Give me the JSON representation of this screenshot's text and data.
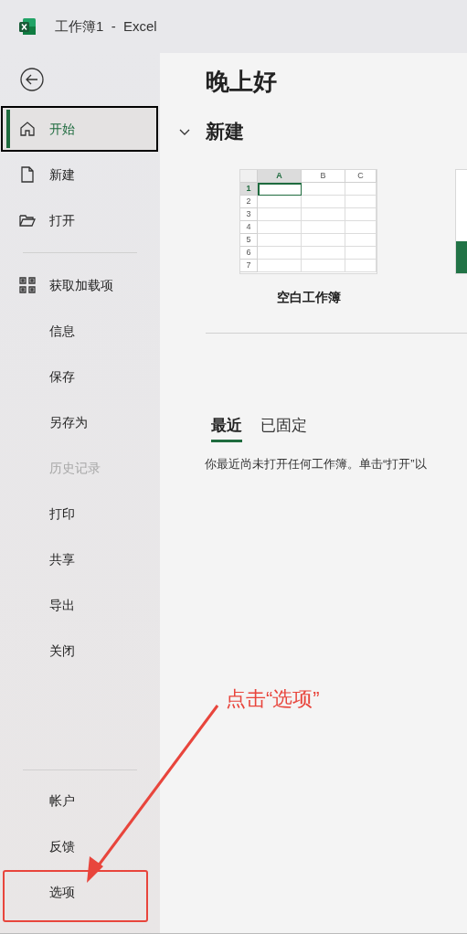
{
  "window": {
    "title": "工作簿1  -  Excel"
  },
  "sidebar": {
    "primary": [
      {
        "label": "开始",
        "selected": true,
        "disabled": false
      },
      {
        "label": "新建",
        "selected": false,
        "disabled": false
      },
      {
        "label": "打开",
        "selected": false,
        "disabled": false
      }
    ],
    "middle": [
      {
        "label": "获取加载项",
        "selected": false,
        "disabled": false
      },
      {
        "label": "信息",
        "selected": false,
        "disabled": false
      },
      {
        "label": "保存",
        "selected": false,
        "disabled": false
      },
      {
        "label": "另存为",
        "selected": false,
        "disabled": false
      },
      {
        "label": "历史记录",
        "selected": false,
        "disabled": true
      },
      {
        "label": "打印",
        "selected": false,
        "disabled": false
      },
      {
        "label": "共享",
        "selected": false,
        "disabled": false
      },
      {
        "label": "导出",
        "selected": false,
        "disabled": false
      },
      {
        "label": "关闭",
        "selected": false,
        "disabled": false
      }
    ],
    "footer": [
      {
        "label": "帐户",
        "selected": false,
        "disabled": false
      },
      {
        "label": "反馈",
        "selected": false,
        "disabled": false
      },
      {
        "label": "选项",
        "selected": false,
        "disabled": false
      }
    ]
  },
  "main": {
    "greeting": "晚上好",
    "new_section": {
      "title": "新建",
      "expanded": true,
      "templates": [
        {
          "label": "空白工作簿",
          "columns": [
            "A",
            "B",
            "C"
          ],
          "rows": [
            "1",
            "2",
            "3",
            "4",
            "5",
            "6",
            "7"
          ]
        }
      ]
    },
    "tabs": [
      {
        "label": "最近",
        "selected": true
      },
      {
        "label": "已固定",
        "selected": false
      }
    ],
    "message": "你最近尚未打开任何工作簿。单击“打开”以"
  },
  "annotation": {
    "text": "点击“选项”"
  }
}
